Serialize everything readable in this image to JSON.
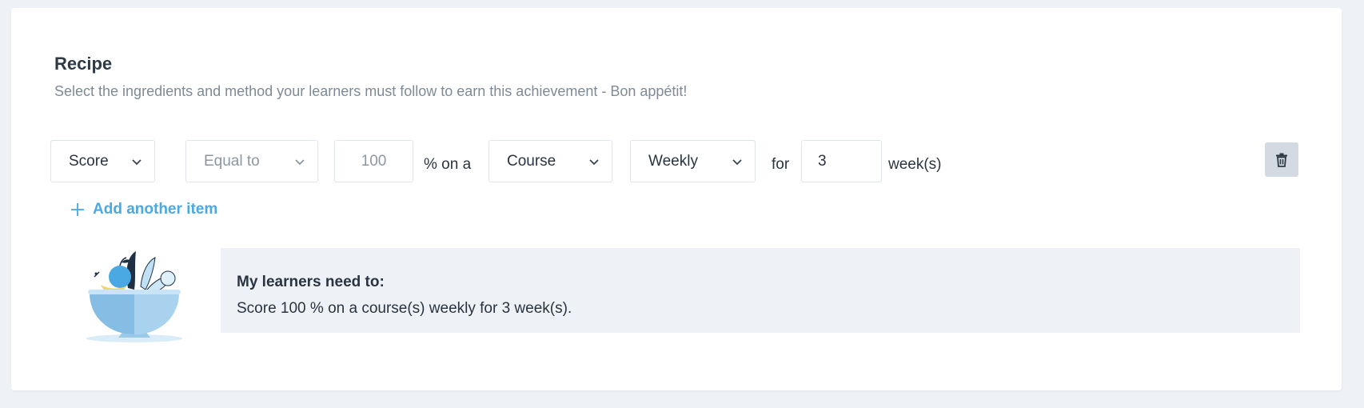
{
  "recipe": {
    "title": "Recipe",
    "subtitle": "Select the ingredients and method your learners must follow to earn this achievement - Bon appétit!"
  },
  "rule": {
    "metric": "Score",
    "comparison_placeholder": "Equal to",
    "value_placeholder": "100",
    "percent_on": "% on a",
    "target": "Course",
    "frequency": "Weekly",
    "for_label": "for",
    "duration_value": "3",
    "unit_label": "week(s)"
  },
  "actions": {
    "add_item": "Add another item",
    "delete_icon": "trash-icon",
    "add_icon": "plus-icon"
  },
  "summary": {
    "heading": "My learners need to:",
    "text": "Score 100 % on a course(s) weekly for 3 week(s)."
  },
  "colors": {
    "accent": "#4aa9e3",
    "summary_bg": "#eef1f5",
    "delete_bg": "#d3dae1"
  }
}
